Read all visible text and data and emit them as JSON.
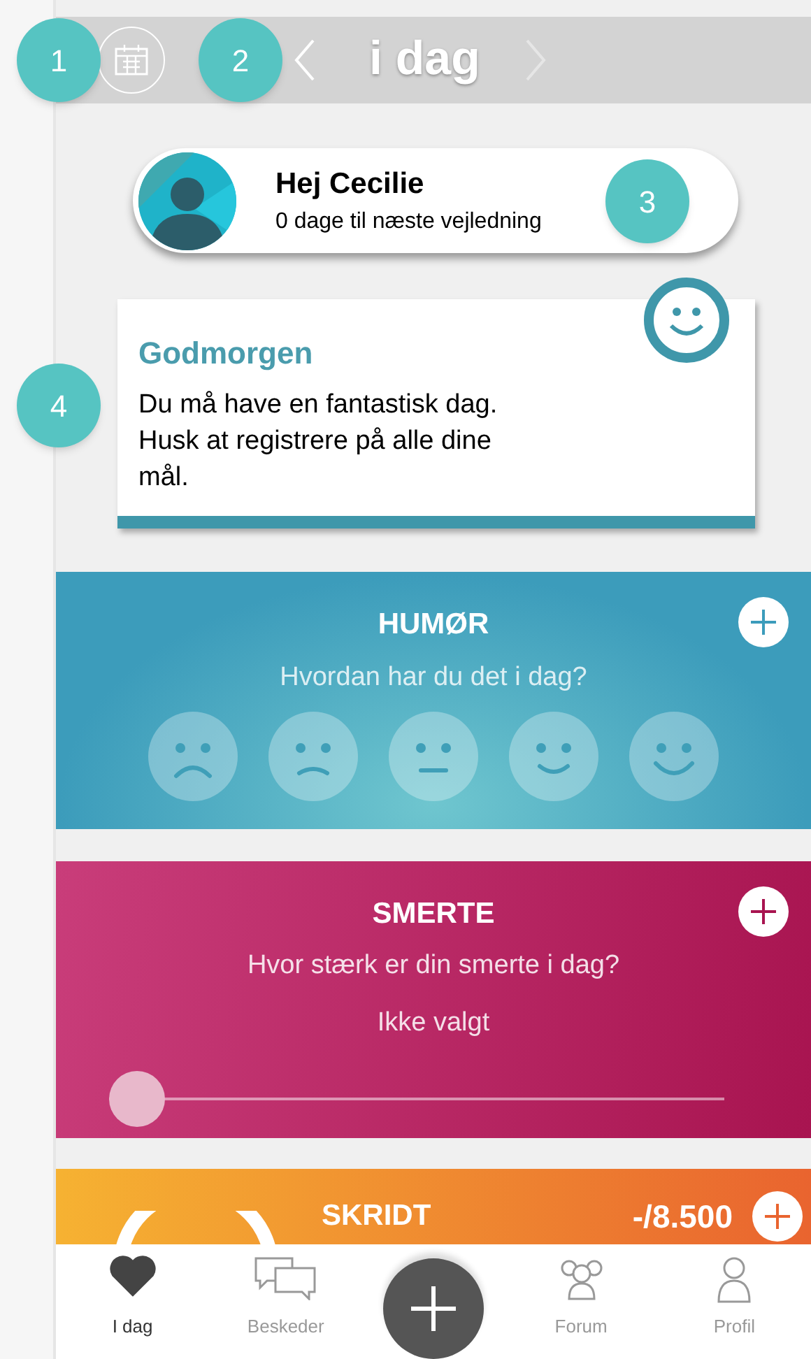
{
  "callouts": [
    "1",
    "2",
    "3",
    "4"
  ],
  "header": {
    "title": "i dag"
  },
  "profile": {
    "name": "Hej Cecilie",
    "subtitle": "0 dage til næste vejledning"
  },
  "message": {
    "title": "Godmorgen",
    "text": "Du må have en fantastisk dag. Husk at registrere på alle dine mål."
  },
  "mood": {
    "title": "HUMØR",
    "question": "Hvordan har du det i dag?"
  },
  "pain": {
    "title": "SMERTE",
    "question": "Hvor stærk er din smerte i dag?",
    "value": "Ikke valgt",
    "level": 0
  },
  "steps": {
    "title": "SKRIDT",
    "value": "-/8.500"
  },
  "tabs": [
    {
      "label": "I dag",
      "selected": true,
      "kind": "heart"
    },
    {
      "label": "Beskeder",
      "selected": false,
      "kind": "chat"
    },
    {
      "kind": "add",
      "selected": false
    },
    {
      "label": "Forum",
      "selected": false,
      "kind": "group"
    },
    {
      "label": "Profil",
      "selected": false,
      "kind": "person"
    }
  ]
}
